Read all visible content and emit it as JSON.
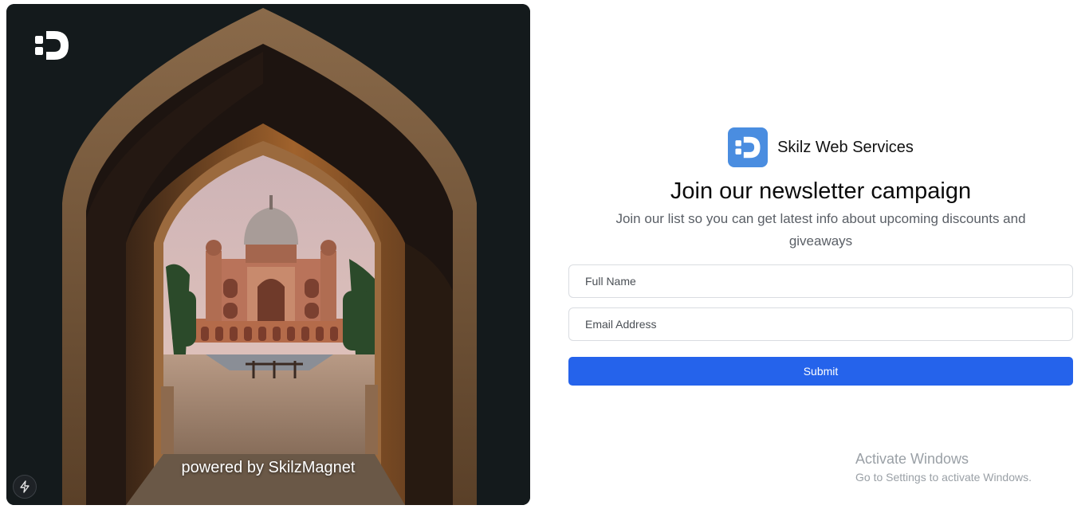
{
  "hero": {
    "image_label": "Arched gateway framing Safdarjung Tomb",
    "powered_by": "powered by SkilzMagnet",
    "logo_icon": "skilz-logo-icon",
    "bolt_icon": "lightning-bolt-icon"
  },
  "brand": {
    "name": "Skilz Web Services",
    "logo_color": "#4a8de0"
  },
  "form": {
    "title": "Join our newsletter campaign",
    "subtitle": "Join our list so you can get latest info about upcoming discounts and giveaways",
    "full_name_placeholder": "Full Name",
    "email_placeholder": "Email Address",
    "submit_label": "Submit",
    "submit_color": "#2563eb"
  },
  "watermark": {
    "title": "Activate Windows",
    "subtitle": "Go to Settings to activate Windows."
  }
}
